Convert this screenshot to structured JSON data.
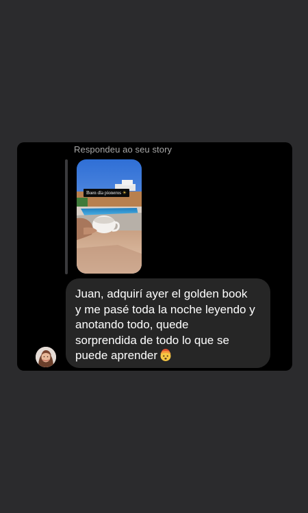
{
  "reply": {
    "label": "Respondeu ao seu story"
  },
  "story": {
    "caption": "Buen día pioneros",
    "caption_emoji": "☀"
  },
  "message": {
    "text": "Juan, adquirí ayer el golden book\ny me pasé toda la noche leyendo y\nanotando todo, quede\nsorprendida de todo lo que se\npuede aprender",
    "emoji_icon": "exploding-head-emoji"
  },
  "colors": {
    "page_background": "#2b2b2d",
    "chat_background": "#000000",
    "bubble_background": "#262626",
    "label_text": "#a8a8a8",
    "message_text": "#ffffff"
  }
}
